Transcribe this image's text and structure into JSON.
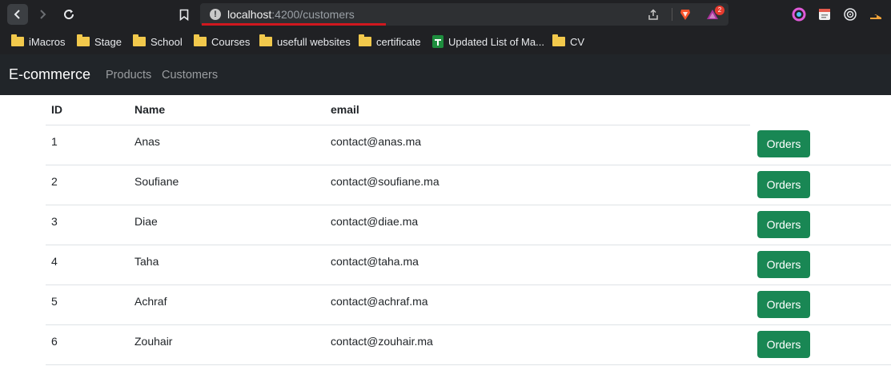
{
  "browser": {
    "url_host": "localhost",
    "url_path": ":4200/customers",
    "url_info_glyph": "!",
    "rewards_count": "2"
  },
  "bookmarks": [
    {
      "label": "iMacros",
      "icon": "folder-icon"
    },
    {
      "label": "Stage",
      "icon": "folder-icon"
    },
    {
      "label": "School",
      "icon": "folder-icon"
    },
    {
      "label": "Courses",
      "icon": "folder-icon"
    },
    {
      "label": "usefull websites",
      "icon": "folder-icon"
    },
    {
      "label": "certificate",
      "icon": "folder-icon"
    },
    {
      "label": "Updated List of Ma...",
      "icon": "sheets-icon"
    },
    {
      "label": "CV",
      "icon": "folder-icon"
    }
  ],
  "navbar": {
    "brand": "E-commerce",
    "links": [
      "Products",
      "Customers"
    ]
  },
  "table": {
    "headers": [
      "ID",
      "Name",
      "email"
    ],
    "rows": [
      {
        "id": "1",
        "name": "Anas",
        "email": "contact@anas.ma",
        "action": "Orders"
      },
      {
        "id": "2",
        "name": "Soufiane",
        "email": "contact@soufiane.ma",
        "action": "Orders"
      },
      {
        "id": "3",
        "name": "Diae",
        "email": "contact@diae.ma",
        "action": "Orders"
      },
      {
        "id": "4",
        "name": "Taha",
        "email": "contact@taha.ma",
        "action": "Orders"
      },
      {
        "id": "5",
        "name": "Achraf",
        "email": "contact@achraf.ma",
        "action": "Orders"
      },
      {
        "id": "6",
        "name": "Zouhair",
        "email": "contact@zouhair.ma",
        "action": "Orders"
      }
    ]
  },
  "colors": {
    "navbar_bg": "#212529",
    "button_bg": "#198754",
    "browser_bg": "#202124"
  }
}
